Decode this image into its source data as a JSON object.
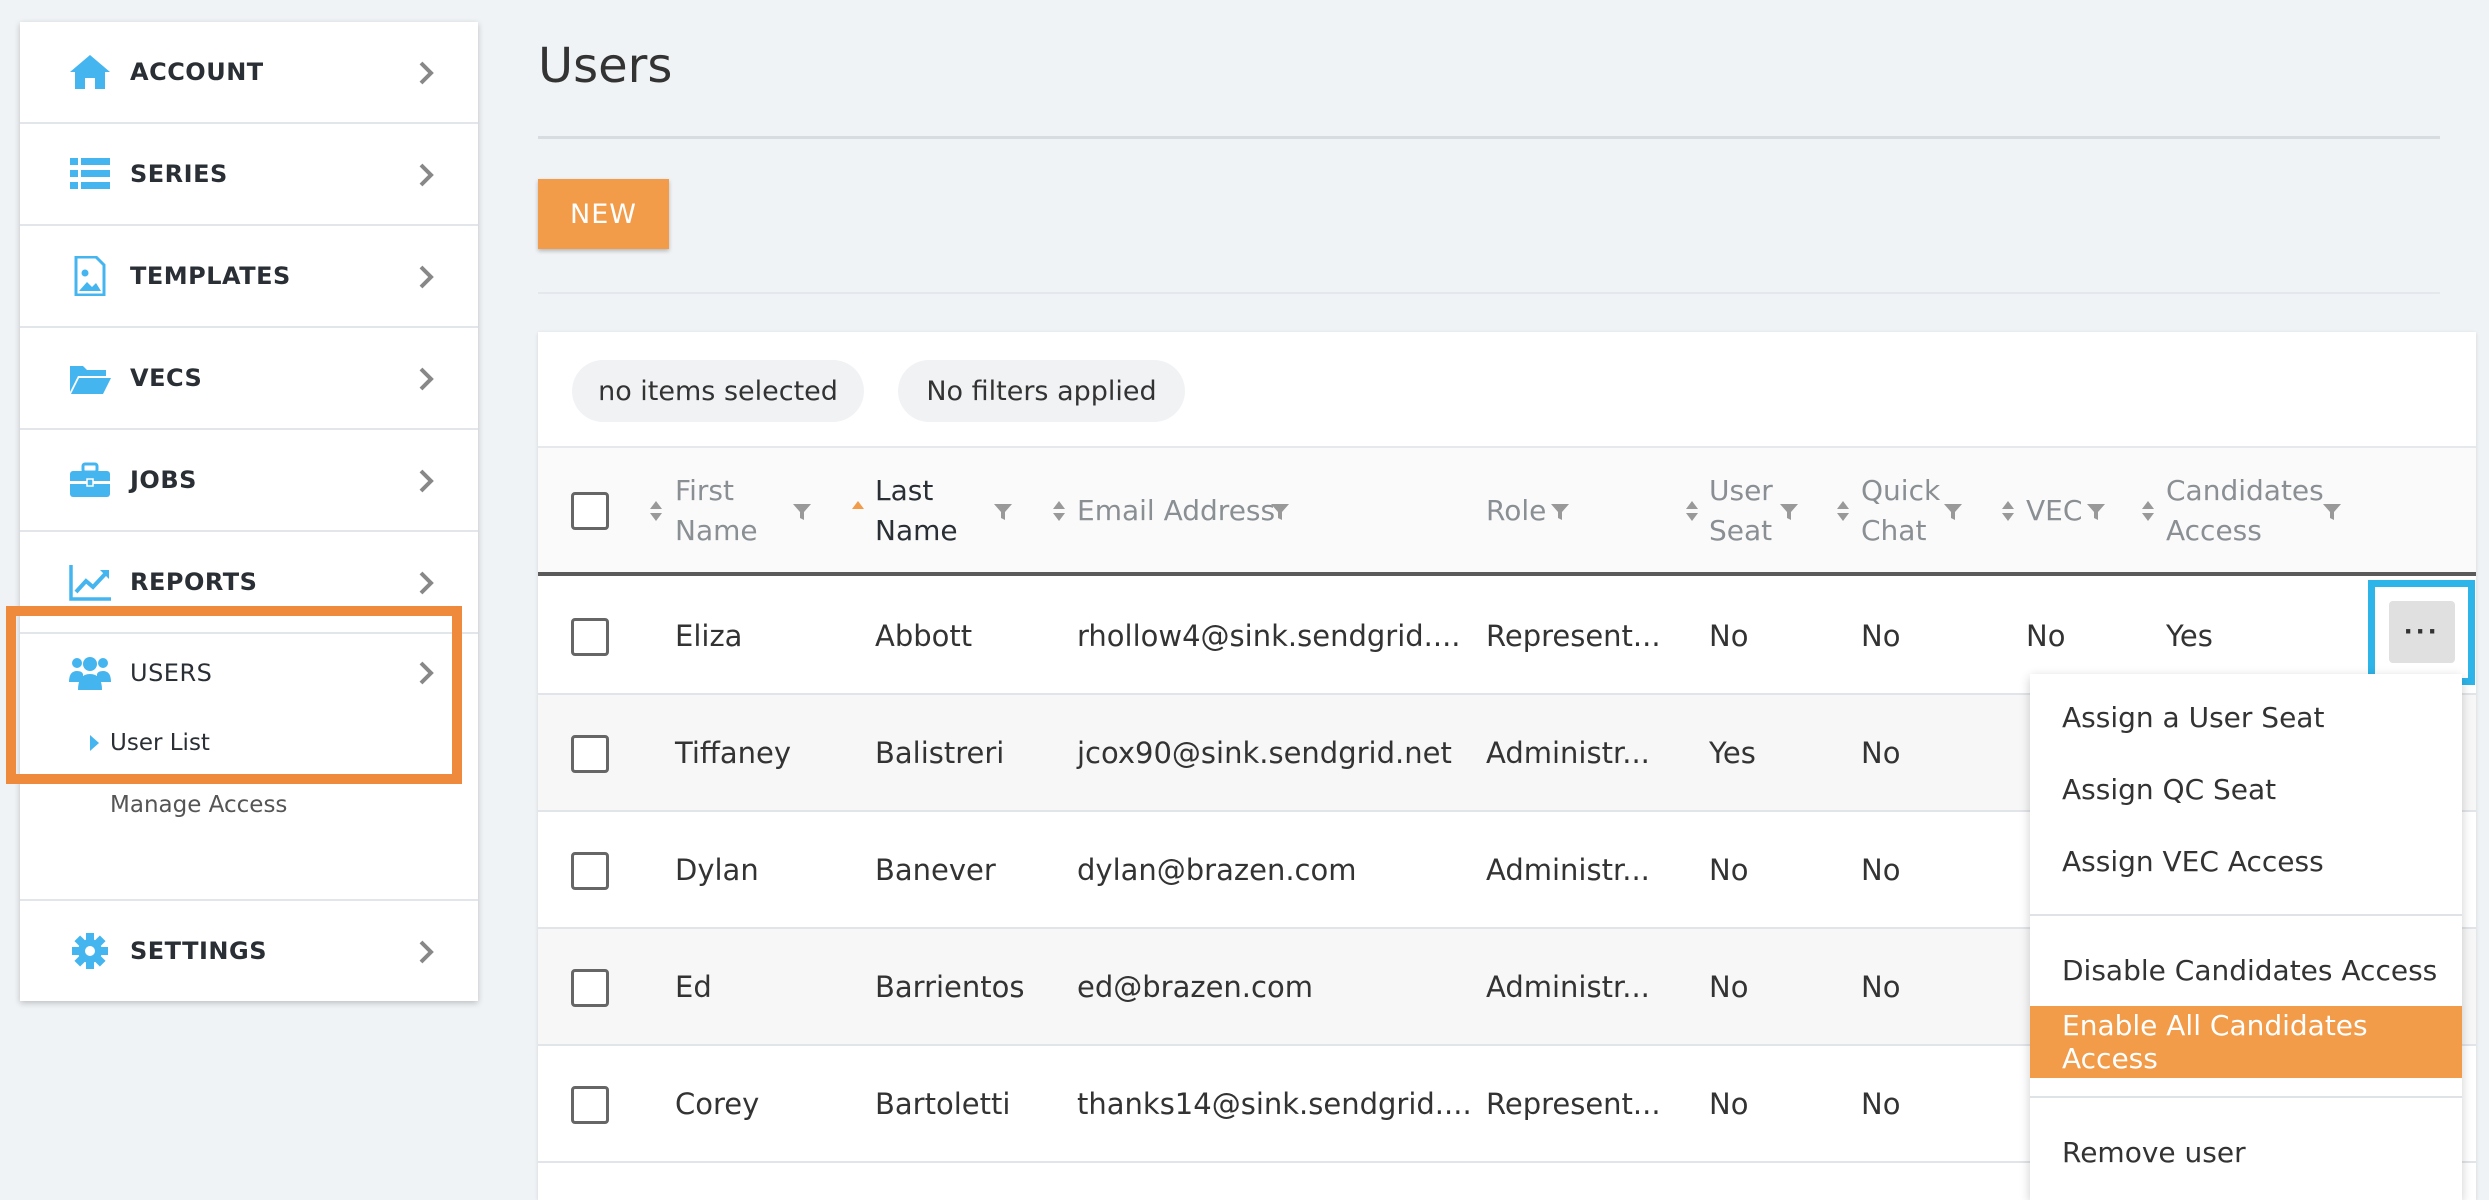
{
  "sidebar": {
    "items": [
      {
        "label": "ACCOUNT",
        "icon": "home-icon"
      },
      {
        "label": "SERIES",
        "icon": "list-icon"
      },
      {
        "label": "TEMPLATES",
        "icon": "image-file-icon"
      },
      {
        "label": "VECS",
        "icon": "folder-icon"
      },
      {
        "label": "JOBS",
        "icon": "briefcase-icon"
      },
      {
        "label": "REPORTS",
        "icon": "chart-line-icon"
      },
      {
        "label": "USERS",
        "icon": "users-icon"
      },
      {
        "label": "SETTINGS",
        "icon": "gear-icon"
      }
    ],
    "users_sub": {
      "active": "User List",
      "inactive": "Manage Access"
    }
  },
  "page": {
    "title": "Users",
    "new_label": "NEW"
  },
  "toolbar": {
    "selected": "no items selected",
    "filters": "No filters applied"
  },
  "table": {
    "headers": {
      "first": [
        "First",
        "Name"
      ],
      "last": [
        "Last",
        "Name"
      ],
      "email": "Email Address",
      "role": "Role",
      "seat": [
        "User",
        "Seat"
      ],
      "chat": [
        "Quick",
        "Chat"
      ],
      "vec": "VEC",
      "cand": [
        "Candidates",
        "Access"
      ]
    },
    "rows": [
      {
        "first": "Eliza",
        "last": "Abbott",
        "email": "rhollow4@sink.sendgrid....",
        "role": "Represent...",
        "seat": "No",
        "chat": "No",
        "vec": "No",
        "cand": "Yes"
      },
      {
        "first": "Tiffaney",
        "last": "Balistreri",
        "email": "jcox90@sink.sendgrid.net",
        "role": "Administr...",
        "seat": "Yes",
        "chat": "No",
        "vec": "",
        "cand": ""
      },
      {
        "first": "Dylan",
        "last": "Banever",
        "email": "dylan@brazen.com",
        "role": "Administr...",
        "seat": "No",
        "chat": "No",
        "vec": "",
        "cand": ""
      },
      {
        "first": "Ed",
        "last": "Barrientos",
        "email": "ed@brazen.com",
        "role": "Administr...",
        "seat": "No",
        "chat": "No",
        "vec": "",
        "cand": ""
      },
      {
        "first": "Corey",
        "last": "Bartoletti",
        "email": "thanks14@sink.sendgrid....",
        "role": "Represent...",
        "seat": "No",
        "chat": "No",
        "vec": "",
        "cand": ""
      }
    ],
    "more_label": "···"
  },
  "menu": {
    "items": [
      "Assign a User Seat",
      "Assign QC Seat",
      "Assign VEC Access",
      "Disable Candidates Access",
      "Enable All Candidates Access",
      "Remove user"
    ]
  },
  "colors": {
    "accent": "#f29b48",
    "icon": "#45b5f0",
    "highlight_border": "#ef8a3c",
    "focus_border": "#2db4e8"
  }
}
